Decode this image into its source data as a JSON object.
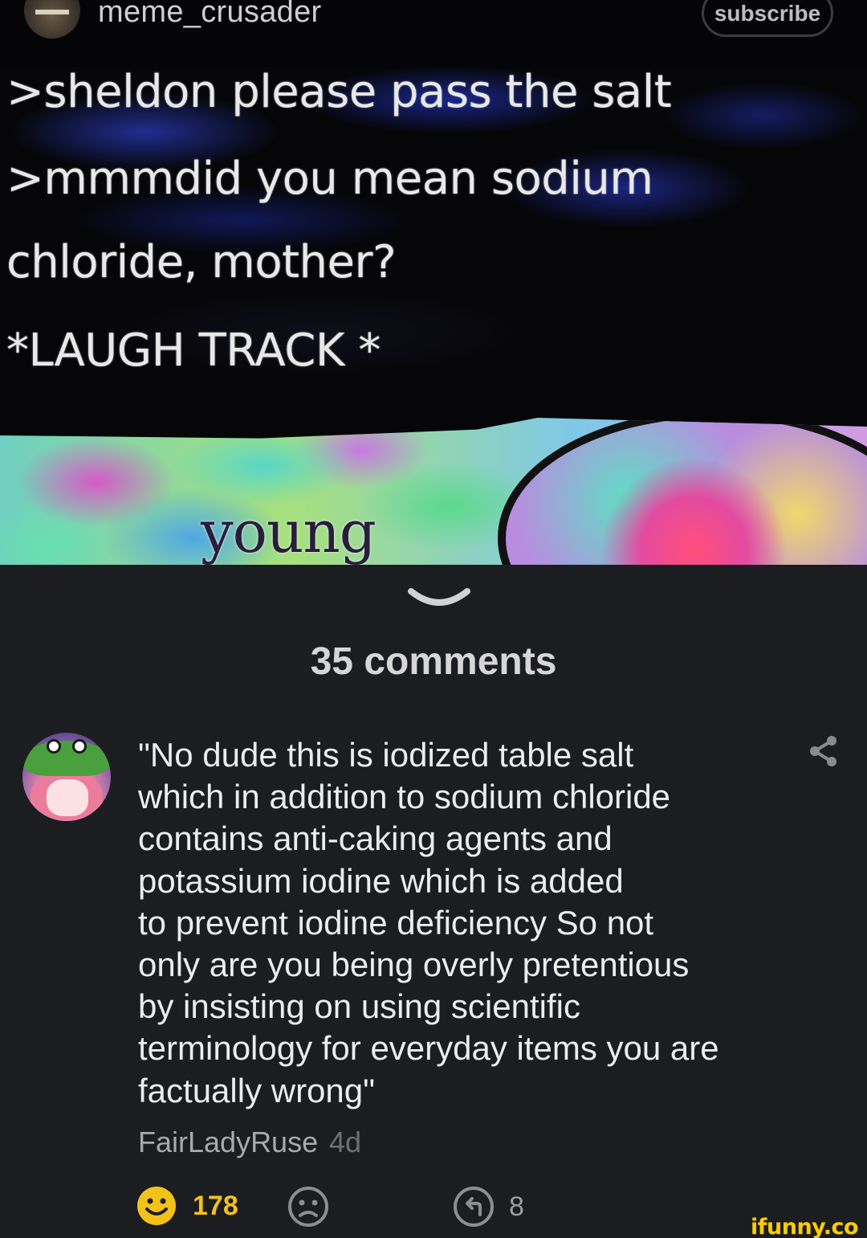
{
  "post": {
    "username": "meme_crusader",
    "subscribe_label": "subscribe",
    "meme_lines": [
      ">sheldon please pass the salt",
      ">mmmdid you mean sodium",
      "chloride, mother?",
      "*LAUGH TRACK *"
    ],
    "image_word": "young"
  },
  "comments_header": "35 comments",
  "comment": {
    "text": "\"No dude this is iodized table salt\nwhich in addition to sodium chloride\ncontains anti-caking agents and\npotassium iodine which is added\nto prevent iodine deficiency So not\nonly are you being overly pretentious\nby insisting on using scientific\nterminology for everyday items you are\nfactually wrong\"",
    "author": "FairLadyRuse",
    "age": "4d",
    "smile_count": "178",
    "reply_count": "8"
  },
  "watermark": "ifunny.co",
  "colors": {
    "background": "#1c1d21",
    "smile_accent": "#f3c21a",
    "watermark": "#ffcc00"
  },
  "icons": [
    "chevron-down-icon",
    "share-icon",
    "smile-icon",
    "frown-icon",
    "reply-icon"
  ]
}
